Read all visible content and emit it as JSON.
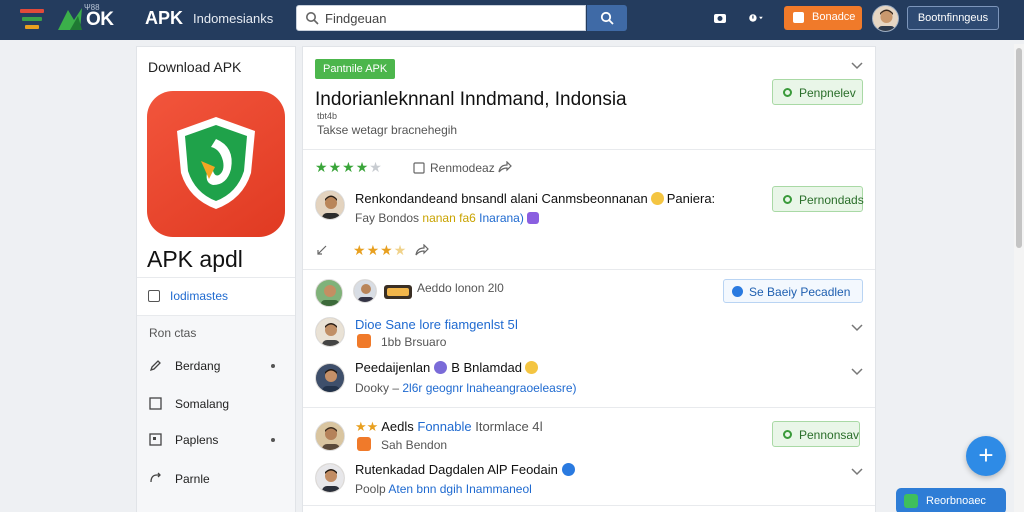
{
  "topbar": {
    "logo_small": "Ψ88",
    "logo_word": "OK",
    "app_name": "APK",
    "app_subtitle": "Indomesianks",
    "search_value": "Findgeuan",
    "orange_button": "Bonadce",
    "user_button": "Bootnfinngeus"
  },
  "sidebar": {
    "title": "Download APK",
    "app_title": "APK apdl",
    "link": "Iodimastes",
    "section_title": "Ron ctas",
    "items": [
      {
        "label": "Berdang",
        "has_dot": true
      },
      {
        "label": "Somalang",
        "has_dot": false
      },
      {
        "label": "Paplens",
        "has_dot": true
      },
      {
        "label": "Parnle",
        "has_dot": false
      }
    ]
  },
  "main": {
    "badge": "Pantnile APK",
    "title": "Indorianleknnanl Inndmand, Indonsia",
    "small_text": "tbt4b",
    "subtitle": "Takse wetagr bracnehegih",
    "header_button": "Penpnelev",
    "rating": {
      "filled": 4,
      "total": 5,
      "count": "Renmodeaz"
    },
    "review_line": "Renkondandeand bnsandl alani Canmsbeonnanan",
    "review_line_tail": "Paniera:",
    "review_sub_prefix": "Fay Bondos",
    "review_sub_highlight": "nanan",
    "review_sub_mid": "fa6",
    "review_sub_blue": "Inarana)",
    "review_button": "Pernondads",
    "rating2": {
      "filled": 3,
      "total": 4
    },
    "comment_header": "Aeddo lonon 2Ɩ0",
    "share_button": "Se Baeiy    Pecadlen",
    "comments": [
      {
        "name": "Dioe Sane lore fiamgenlst 5ǀ",
        "sub": "1bb  Brsuaro",
        "blue_name": true
      },
      {
        "name": "Peedaijenlan",
        "name_tail": "B Bnlamdad",
        "sub_prefix": "Dooky",
        "sub_blue": "2l6r geognr lnaheangraoeleasre)"
      },
      {
        "name": "Aedls",
        "name_blue": "Fonnable",
        "name_tail": "Itormlace  4ǀ",
        "sub": "Sah Bendon",
        "button": "Pennonsav"
      },
      {
        "name": "Rutenkadad",
        "name_tail": "Dagdalen AlP Feodain",
        "sub_prefix": "Poolp",
        "sub_blue": "Aten bnn dgih Inammaneol"
      }
    ]
  },
  "fab_label": "+",
  "toast": "Reorbnoaec"
}
